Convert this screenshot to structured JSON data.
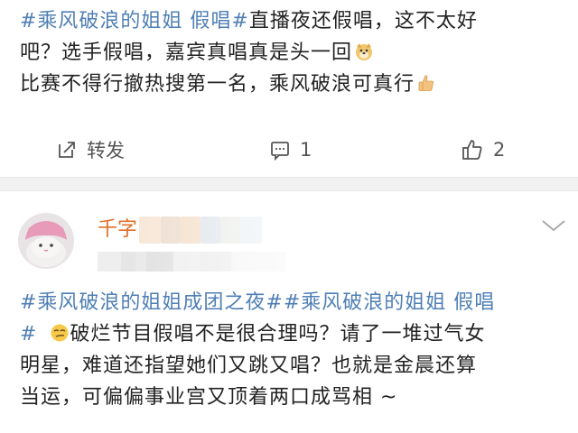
{
  "post1": {
    "tag": "#乘风破浪的姐姐 假唱#",
    "line1_text": "直播夜还假唱，这不太好",
    "line2_text": "吧？选手假唱，嘉宾真唱真是头一回",
    "line3_text": "比赛不得行撤热搜第一名，乘风破浪可真行",
    "emoji_1": "doge-emoji",
    "emoji_2": "thumbs-up-emoji"
  },
  "actions": {
    "repost_label": "转发",
    "comment_count": "1",
    "like_count": "2",
    "repost_icon": "repost-icon",
    "comment_icon": "comment-icon",
    "like_icon": "thumbs-up-icon"
  },
  "post2": {
    "username": "千字",
    "tag_1": "#乘风破浪的姐姐成团之夜#",
    "tag_2": "#乘风破浪的姐姐 假唱",
    "tag_2_end": "#",
    "line2_text": "破烂节目假唱不是很合理吗？请了一堆过气女",
    "line3_text": "明星，难道还指望她们又跳又唱？也就是金晨还算",
    "line4_text": "当运，可偏偏事业宫又顶着两口成骂相 ~",
    "emoji_1": "smirk-emoji",
    "more_icon": "chevron-down-icon"
  },
  "colors": {
    "tag": "#4f7fb5",
    "text": "#222222",
    "action": "#555555",
    "divider": "#f2f2f2",
    "username": "#e0702a"
  }
}
